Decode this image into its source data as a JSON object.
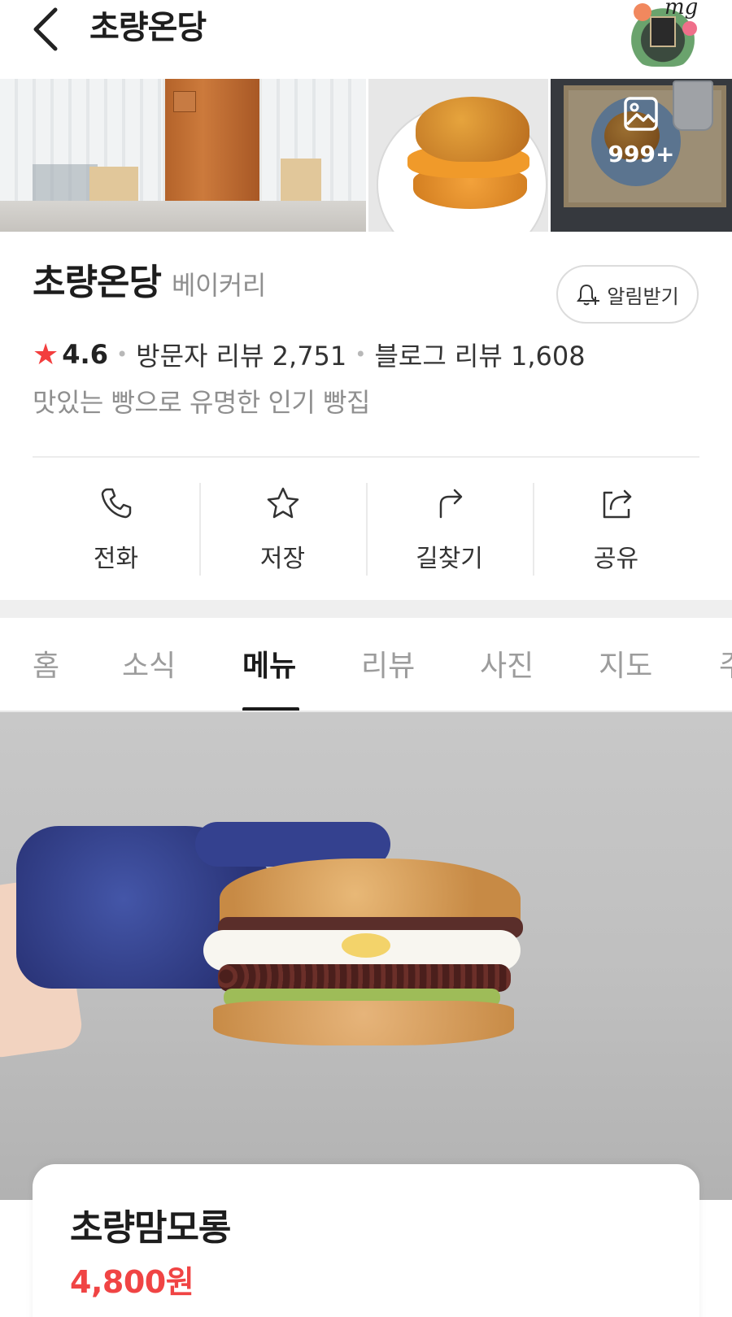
{
  "header": {
    "title": "초량온당",
    "avatar_text": "mg"
  },
  "photos": {
    "more_count": "999+"
  },
  "place": {
    "name": "초량온당",
    "category": "베이커리",
    "alarm_label": "알림받기",
    "rating": "4.6",
    "visitor_reviews": "방문자 리뷰 2,751",
    "blog_reviews": "블로그 리뷰 1,608",
    "description": "맛있는 빵으로 유명한 인기 빵집"
  },
  "actions": [
    {
      "label": "전화",
      "icon": "phone-icon"
    },
    {
      "label": "저장",
      "icon": "star-icon"
    },
    {
      "label": "길찾기",
      "icon": "directions-icon"
    },
    {
      "label": "공유",
      "icon": "share-icon"
    }
  ],
  "tabs": [
    {
      "label": "홈"
    },
    {
      "label": "소식"
    },
    {
      "label": "메뉴",
      "active": true
    },
    {
      "label": "리뷰"
    },
    {
      "label": "사진"
    },
    {
      "label": "지도"
    },
    {
      "label": "주"
    }
  ],
  "menu": {
    "name": "초량맘모롱",
    "price": "4,800원"
  },
  "colors": {
    "accent_red": "#f04444",
    "star": "#f33e3e",
    "text_primary": "#1d1d1d",
    "text_muted": "#8f8f8f"
  }
}
